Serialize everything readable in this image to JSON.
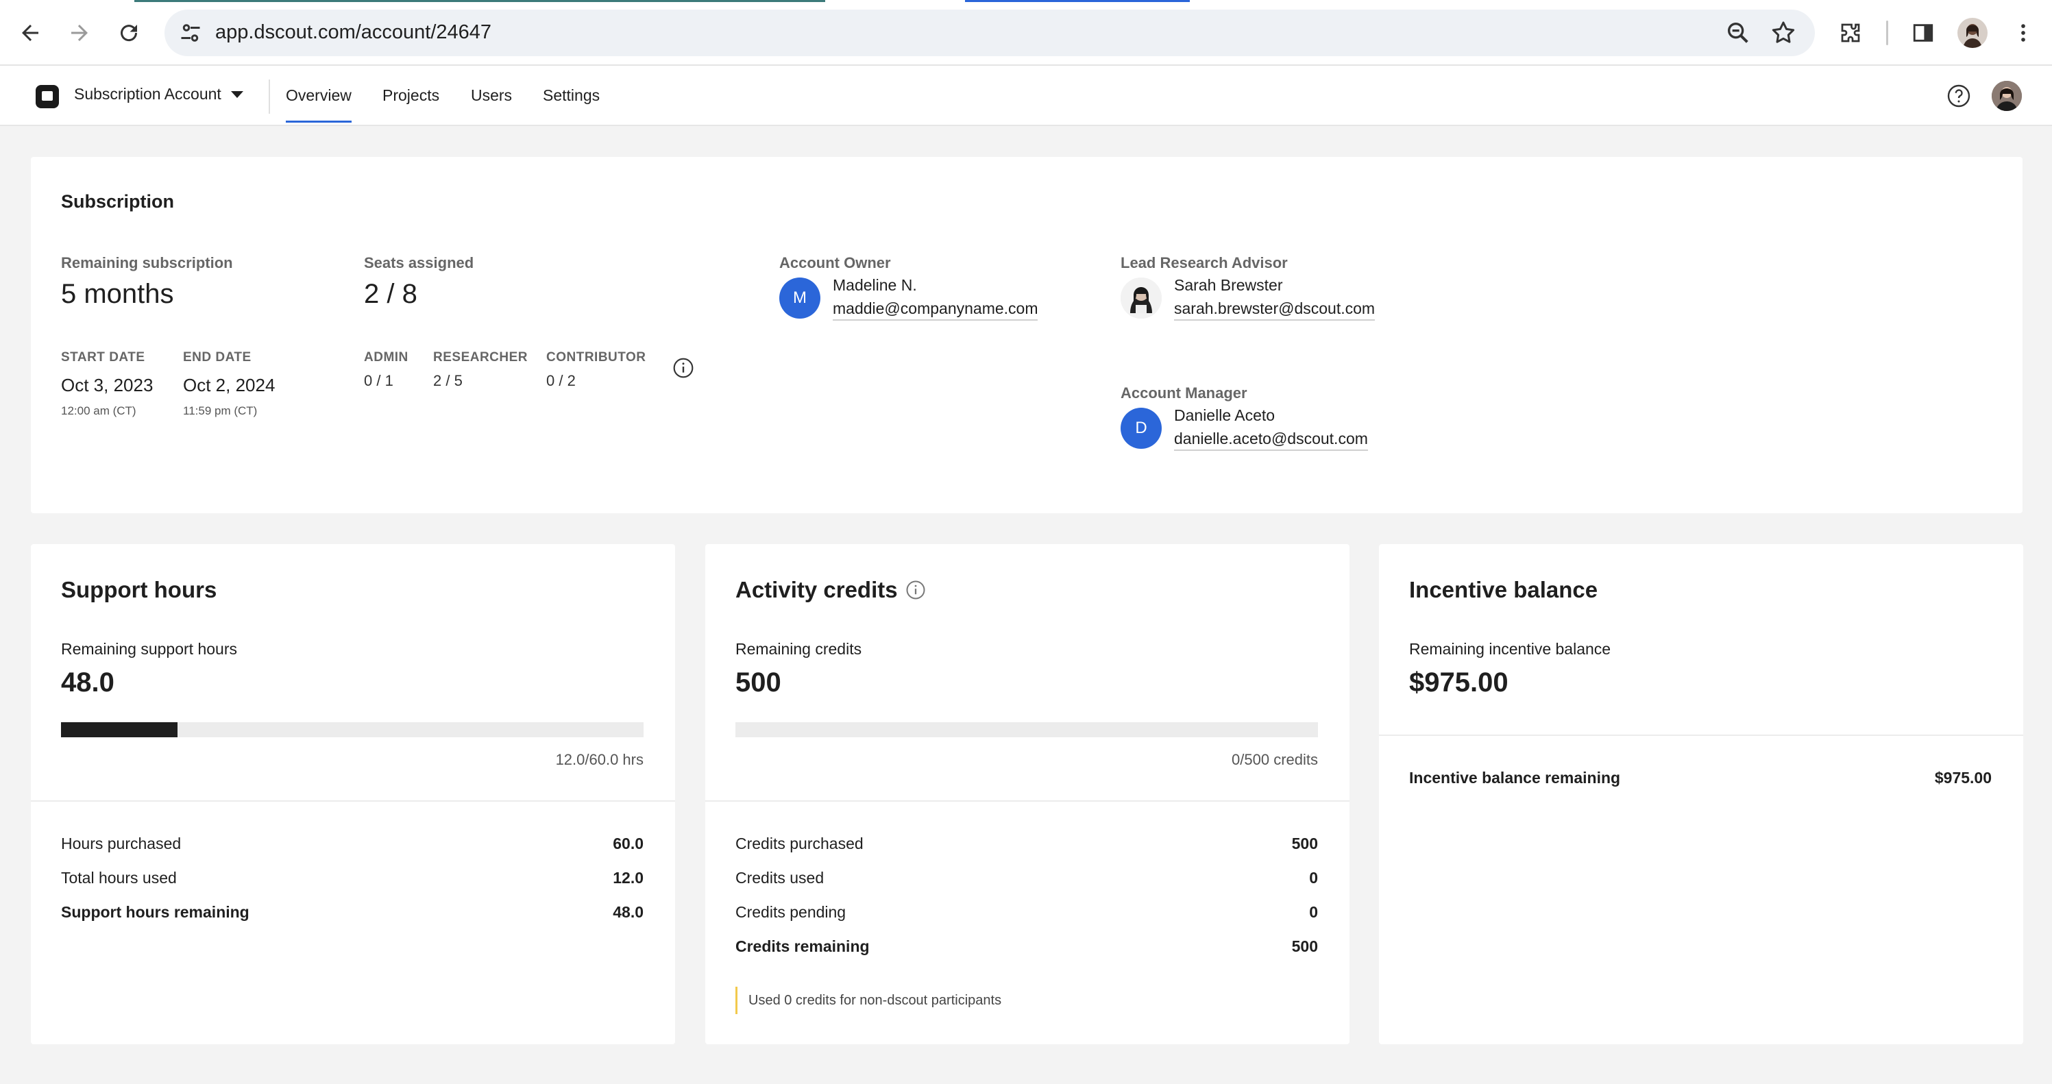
{
  "browser": {
    "url": "app.dscout.com/account/24647"
  },
  "header": {
    "account_label": "Subscription Account",
    "tabs": [
      {
        "label": "Overview",
        "active": true
      },
      {
        "label": "Projects",
        "active": false
      },
      {
        "label": "Users",
        "active": false
      },
      {
        "label": "Settings",
        "active": false
      }
    ],
    "accent_color": "#2b66d9"
  },
  "subscription": {
    "title": "Subscription",
    "remaining_label": "Remaining subscription",
    "remaining_value": "5 months",
    "start_caption": "START DATE",
    "start_date": "Oct 3, 2023",
    "start_time": "12:00 am (CT)",
    "end_caption": "END DATE",
    "end_date": "Oct 2, 2024",
    "end_time": "11:59 pm (CT)",
    "seats_label": "Seats assigned",
    "seats_value": "2 / 8",
    "roles": [
      {
        "caption": "ADMIN",
        "value": "0 / 1"
      },
      {
        "caption": "RESEARCHER",
        "value": "2 / 5"
      },
      {
        "caption": "CONTRIBUTOR",
        "value": "0 / 2"
      }
    ],
    "owner": {
      "role": "Account Owner",
      "initial": "M",
      "name": "Madeline N.",
      "email": "maddie@companyname.com"
    },
    "advisor": {
      "role": "Lead Research Advisor",
      "name": "Sarah Brewster",
      "email": "sarah.brewster@dscout.com"
    },
    "manager": {
      "role": "Account Manager",
      "initial": "D",
      "name": "Danielle Aceto",
      "email": "danielle.aceto@dscout.com"
    }
  },
  "support_hours": {
    "title": "Support hours",
    "sub_label": "Remaining support hours",
    "big_value": "48.0",
    "progress_fraction": 0.2,
    "bar_note": "12.0/60.0 hrs",
    "rows": [
      {
        "name": "Hours purchased",
        "value": "60.0"
      },
      {
        "name": "Total hours used",
        "value": "12.0"
      },
      {
        "name": "Support hours remaining",
        "value": "48.0"
      }
    ]
  },
  "activity_credits": {
    "title": "Activity credits",
    "sub_label": "Remaining credits",
    "big_value": "500",
    "progress_fraction": 0,
    "bar_note": "0/500 credits",
    "rows": [
      {
        "name": "Credits purchased",
        "value": "500"
      },
      {
        "name": "Credits used",
        "value": "0"
      },
      {
        "name": "Credits pending",
        "value": "0"
      },
      {
        "name": "Credits remaining",
        "value": "500"
      }
    ],
    "note": "Used 0 credits for non-dscout participants"
  },
  "incentive": {
    "title": "Incentive balance",
    "sub_label": "Remaining incentive balance",
    "big_value": "$975.00",
    "rows": [
      {
        "name": "Incentive balance remaining",
        "value": "$975.00"
      }
    ]
  }
}
